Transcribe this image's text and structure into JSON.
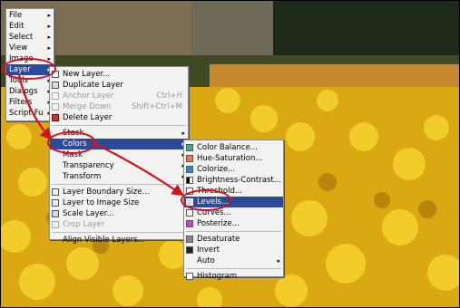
{
  "image_menu": {
    "items": [
      {
        "label": "File"
      },
      {
        "label": "Edit"
      },
      {
        "label": "Select"
      },
      {
        "label": "View"
      },
      {
        "label": "Image"
      },
      {
        "label": "Layer"
      },
      {
        "label": "Tools"
      },
      {
        "label": "Dialogs"
      },
      {
        "label": "Filters"
      },
      {
        "label": "Script-Fu"
      }
    ]
  },
  "layer_menu": {
    "items": [
      {
        "label": "New Layer..."
      },
      {
        "label": "Duplicate Layer"
      },
      {
        "label": "Anchor Layer",
        "shortcut": "Ctrl+H"
      },
      {
        "label": "Merge Down",
        "shortcut": "Shift+Ctrl+M"
      },
      {
        "label": "Delete Layer"
      },
      {
        "label": "Stack"
      },
      {
        "label": "Colors"
      },
      {
        "label": "Mask"
      },
      {
        "label": "Transparency"
      },
      {
        "label": "Transform"
      },
      {
        "label": "Layer Boundary Size..."
      },
      {
        "label": "Layer to Image Size"
      },
      {
        "label": "Scale Layer..."
      },
      {
        "label": "Crop Layer"
      },
      {
        "label": "Align Visible Layers..."
      }
    ]
  },
  "colors_menu": {
    "items": [
      {
        "label": "Color Balance..."
      },
      {
        "label": "Hue-Saturation..."
      },
      {
        "label": "Colorize..."
      },
      {
        "label": "Brightness-Contrast..."
      },
      {
        "label": "Threshold..."
      },
      {
        "label": "Levels..."
      },
      {
        "label": "Curves..."
      },
      {
        "label": "Posterize..."
      },
      {
        "label": "Desaturate"
      },
      {
        "label": "Invert"
      },
      {
        "label": "Auto"
      },
      {
        "label": "Histogram"
      }
    ]
  },
  "colors": {
    "highlight": "#2c4a9a",
    "annotation": "#d8101a"
  }
}
